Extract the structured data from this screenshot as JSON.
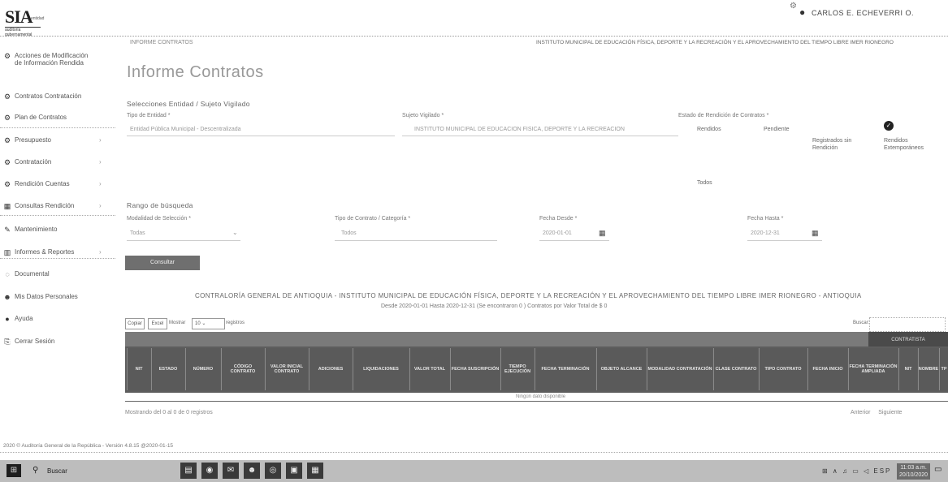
{
  "header": {
    "logo_text": "SIA",
    "logo_small": "entidad",
    "logo_tag": "auditoría gubernamental",
    "settings_icon": "gear-icon",
    "user_icon": "user-icon",
    "user_name": "CARLOS E. ECHEVERRI O.",
    "breadcrumb": "INFORME CONTRATOS",
    "institution": "INSTITUTO MUNICIPAL DE EDUCACIÓN FÍSICA, DEPORTE Y LA RECREACIÓN Y EL APROVECHAMIENTO DEL TIEMPO LIBRE IMER RIONEGRO",
    "page_title": "Informe Contratos"
  },
  "sidebar": {
    "items": [
      {
        "icon": "gear-icon",
        "label": "Acciones de Modificación",
        "label2": "de Información Rendida"
      },
      {
        "icon": "gear-icon",
        "label": "Contratos Contratación"
      },
      {
        "icon": "gear-icon",
        "label": "Plan de Contratos"
      },
      {
        "icon": "gear-icon",
        "label": "Presupuesto",
        "arrow": "›"
      },
      {
        "icon": "gear-icon",
        "label": "Contratación",
        "arrow": "›"
      },
      {
        "icon": "gear-icon",
        "label": "Rendición Cuentas",
        "arrow": "›"
      },
      {
        "icon": "grid-icon",
        "label": "Consultas Rendición",
        "arrow": "›"
      },
      {
        "icon": "wrench-icon",
        "label": "Mantenimiento"
      },
      {
        "icon": "chart-icon",
        "label": "Informes & Reportes",
        "arrow": "›"
      },
      {
        "icon": "globe-icon",
        "label": "Documental"
      },
      {
        "icon": "user-icon",
        "label": "Mis Datos Personales"
      },
      {
        "icon": "info-icon",
        "label": "Ayuda"
      },
      {
        "icon": "logout-icon",
        "label": "Cerrar Sesión"
      }
    ]
  },
  "filters": {
    "section1_title": "Selecciones Entidad / Sujeto Vigilado",
    "entity_type_label": "Tipo de Entidad *",
    "entity_type_value": "Entidad Pública Municipal - Descentralizada",
    "subject_label": "Sujeto Vigilado *",
    "subject_value": "INSTITUTO MUNICIPAL DE EDUCACIÓN FÍSICA, DEPORTE Y LA RECREACIÓN",
    "status_label": "Estado de Rendición de Contratos *",
    "status_options": [
      "Rendidos",
      "Pendiente",
      "Registrados sin Rendición",
      "Rendidos Extemporáneos",
      "Todos"
    ],
    "section2_title": "Rango de búsqueda",
    "modality_label": "Modalidad de Selección *",
    "modality_value": "Todas",
    "contract_type_label": "Tipo de Contrato / Categoría *",
    "contract_type_value": "Todos",
    "date_from_label": "Fecha Desde *",
    "date_from_value": "2020-01-01",
    "date_to_label": "Fecha Hasta *",
    "date_to_value": "2020-12-31",
    "consult_button": "Consultar"
  },
  "report": {
    "title": "CONTRALORÍA GENERAL DE ANTIOQUIA - INSTITUTO MUNICIPAL DE EDUCACIÓN FÍSICA, DEPORTE Y LA RECREACIÓN Y EL APROVECHAMIENTO DEL TIEMPO LIBRE IMER RIONEGRO - ANTIOQUIA",
    "subtitle": "Desde 2020-01-01 Hasta 2020-12-31 (Se encontraron 0 ) Contratos por Valor Total de $ 0",
    "toolbar": {
      "copy": "Copiar",
      "excel": "Excel",
      "show": "Mostrar",
      "count": "10",
      "records": "registros",
      "search_label": "Buscar:"
    },
    "group_header": "CONTRATISTA",
    "columns": [
      "NIT",
      "ESTADO",
      "NÚMERO",
      "CÓDIGO CONTRATO",
      "VALOR INICIAL CONTRATO",
      "ADICIONES",
      "LIQUIDACIONES",
      "VALOR TOTAL",
      "FECHA SUSCRIPCIÓN",
      "TIEMPO EJECUCIÓN",
      "FECHA TERMINACIÓN",
      "OBJETO ALCANCE",
      "MODALIDAD CONTRATACIÓN",
      "CLASE CONTRATO",
      "TIPO CONTRATO",
      "FECHA INICIO",
      "FECHA TERMINACIÓN AMPLIADA",
      "NIT",
      "NOMBRE",
      "TP"
    ],
    "no_data": "Ningún dato disponible",
    "showing": "Mostrando del 0 al 0 de 0 registros",
    "prev": "Anterior",
    "next": "Siguiente"
  },
  "footer": {
    "copyright": "2020 © Auditoría General de la República - Versión 4.8.15 @2020-01-15"
  },
  "taskbar": {
    "search": "Buscar",
    "tray": "⊞ ∧ ♫ ▭ ◁ ESP",
    "time": "11:03 a.m.",
    "date": "20/10/2020"
  }
}
